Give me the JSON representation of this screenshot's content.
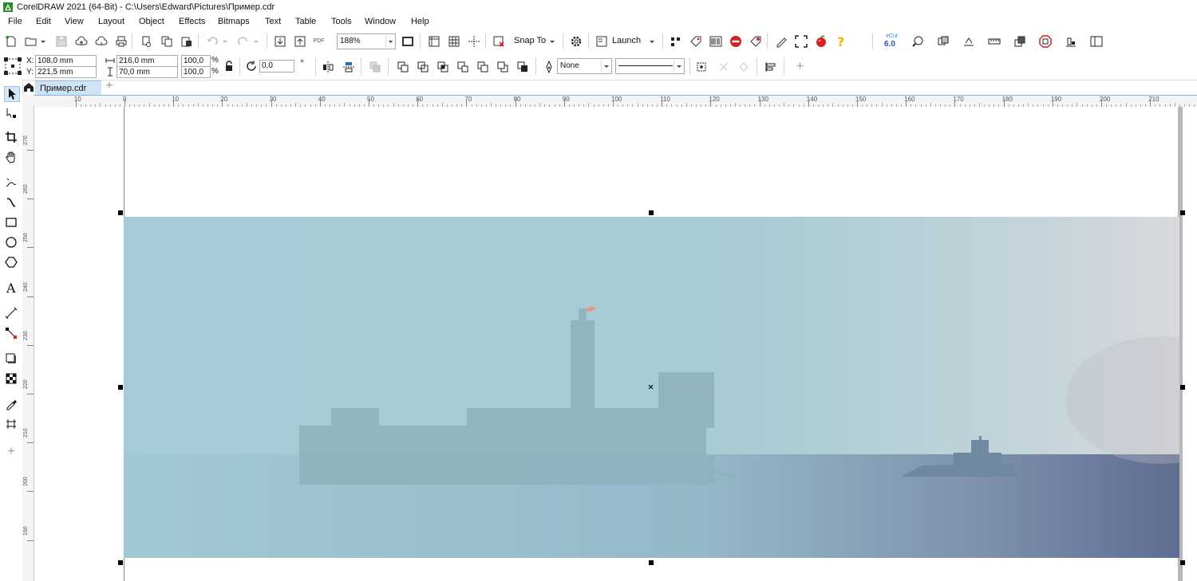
{
  "window": {
    "title": "CorelDRAW 2021 (64-Bit) - C:\\Users\\Edward\\Pictures\\Пример.cdr"
  },
  "menu": [
    "File",
    "Edit",
    "View",
    "Layout",
    "Object",
    "Effects",
    "Bitmaps",
    "Text",
    "Table",
    "Tools",
    "Window",
    "Help"
  ],
  "toolbar": {
    "zoom_value": "188%",
    "pdf_label": "PDF",
    "snap_label": "Snap To",
    "launch_label": "Launch",
    "ecut_label": "eCut",
    "ecut_version": "6.0"
  },
  "properties": {
    "x_label": "X:",
    "x_value": "108,0 mm",
    "y_label": "Y:",
    "y_value": "221,5 mm",
    "width_value": "216,0 mm",
    "height_value": "70,0 mm",
    "scale_x": "100,0",
    "scale_y": "100,0",
    "percent": "%",
    "rotation_value": "0,0",
    "degree": "°",
    "outline_width": "None"
  },
  "tabs": {
    "document": "Пример.cdr"
  },
  "ruler": {
    "h_labels": [
      "10",
      "0",
      "10",
      "20",
      "30",
      "40",
      "50",
      "60",
      "70",
      "80",
      "90",
      "100",
      "110",
      "120",
      "130",
      "140",
      "150",
      "160",
      "170",
      "180",
      "190",
      "200",
      "210"
    ],
    "v_labels": [
      "270",
      "260",
      "250",
      "240",
      "230",
      "220",
      "210",
      "200",
      "190"
    ]
  },
  "colors": {
    "sea_haze": "#a5cdd6",
    "sea_dark": "#5f6f92",
    "selection_handle": "#000000",
    "ruler_bg": "#f4f4f4"
  }
}
